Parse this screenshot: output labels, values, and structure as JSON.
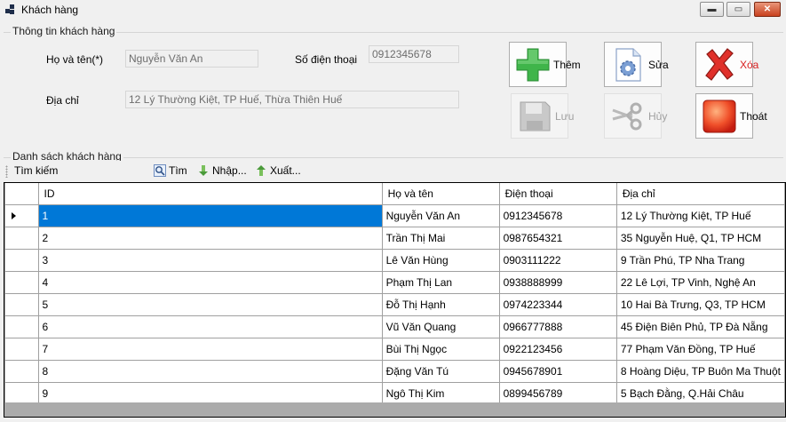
{
  "window": {
    "title": "Khách hàng",
    "minimize_glyph": "▬",
    "maximize_glyph": "▭",
    "close_glyph": "✕"
  },
  "info_group": {
    "title": "Thông tin khách hàng",
    "name_label": "Họ và tên(*)",
    "name_value": "Nguyễn Văn An",
    "phone_label": "Số điện thoại",
    "phone_value": "0912345678",
    "address_label": "Địa chỉ",
    "address_value": "12 Lý Thường Kiệt, TP Huế, Thừa Thiên Huế"
  },
  "buttons": {
    "add": "Thêm",
    "edit": "Sửa",
    "delete": "Xóa",
    "save": "Lưu",
    "cancel": "Hủy",
    "exit": "Thoát"
  },
  "list_group": {
    "title": "Danh sách khách hàng"
  },
  "toolbar": {
    "search_label": "Tìm kiếm",
    "find": "Tìm",
    "import": "Nhập...",
    "export": "Xuất..."
  },
  "table": {
    "columns": [
      "ID",
      "Họ và tên",
      "Điện thoại",
      "Địa chỉ"
    ],
    "rows": [
      {
        "id": "1",
        "name": "Nguyễn Văn An",
        "phone": "0912345678",
        "address": "12 Lý Thường Kiệt, TP Huế"
      },
      {
        "id": "2",
        "name": "Trần Thị Mai",
        "phone": "0987654321",
        "address": "35 Nguyễn Huệ, Q1, TP HCM"
      },
      {
        "id": "3",
        "name": "Lê Văn Hùng",
        "phone": "0903111222",
        "address": "9 Trần Phú, TP Nha Trang"
      },
      {
        "id": "4",
        "name": "Phạm Thị Lan",
        "phone": "0938888999",
        "address": "22 Lê Lợi, TP Vinh, Nghệ An"
      },
      {
        "id": "5",
        "name": "Đỗ Thị Hạnh",
        "phone": "0974223344",
        "address": "10 Hai Bà Trưng, Q3, TP HCM"
      },
      {
        "id": "6",
        "name": "Vũ Văn Quang",
        "phone": "0966777888",
        "address": "45 Điện Biên Phủ, TP Đà Nẵng"
      },
      {
        "id": "7",
        "name": "Bùi Thị Ngọc",
        "phone": "0922123456",
        "address": "77 Phạm Văn Đồng, TP Huế"
      },
      {
        "id": "8",
        "name": "Đặng Văn Tú",
        "phone": "0945678901",
        "address": "8 Hoàng Diệu, TP Buôn Ma Thuột"
      },
      {
        "id": "9",
        "name": "Ngô Thị Kim",
        "phone": "0899456789",
        "address": "5 Bạch Đằng, Q.Hải Châu"
      }
    ]
  }
}
